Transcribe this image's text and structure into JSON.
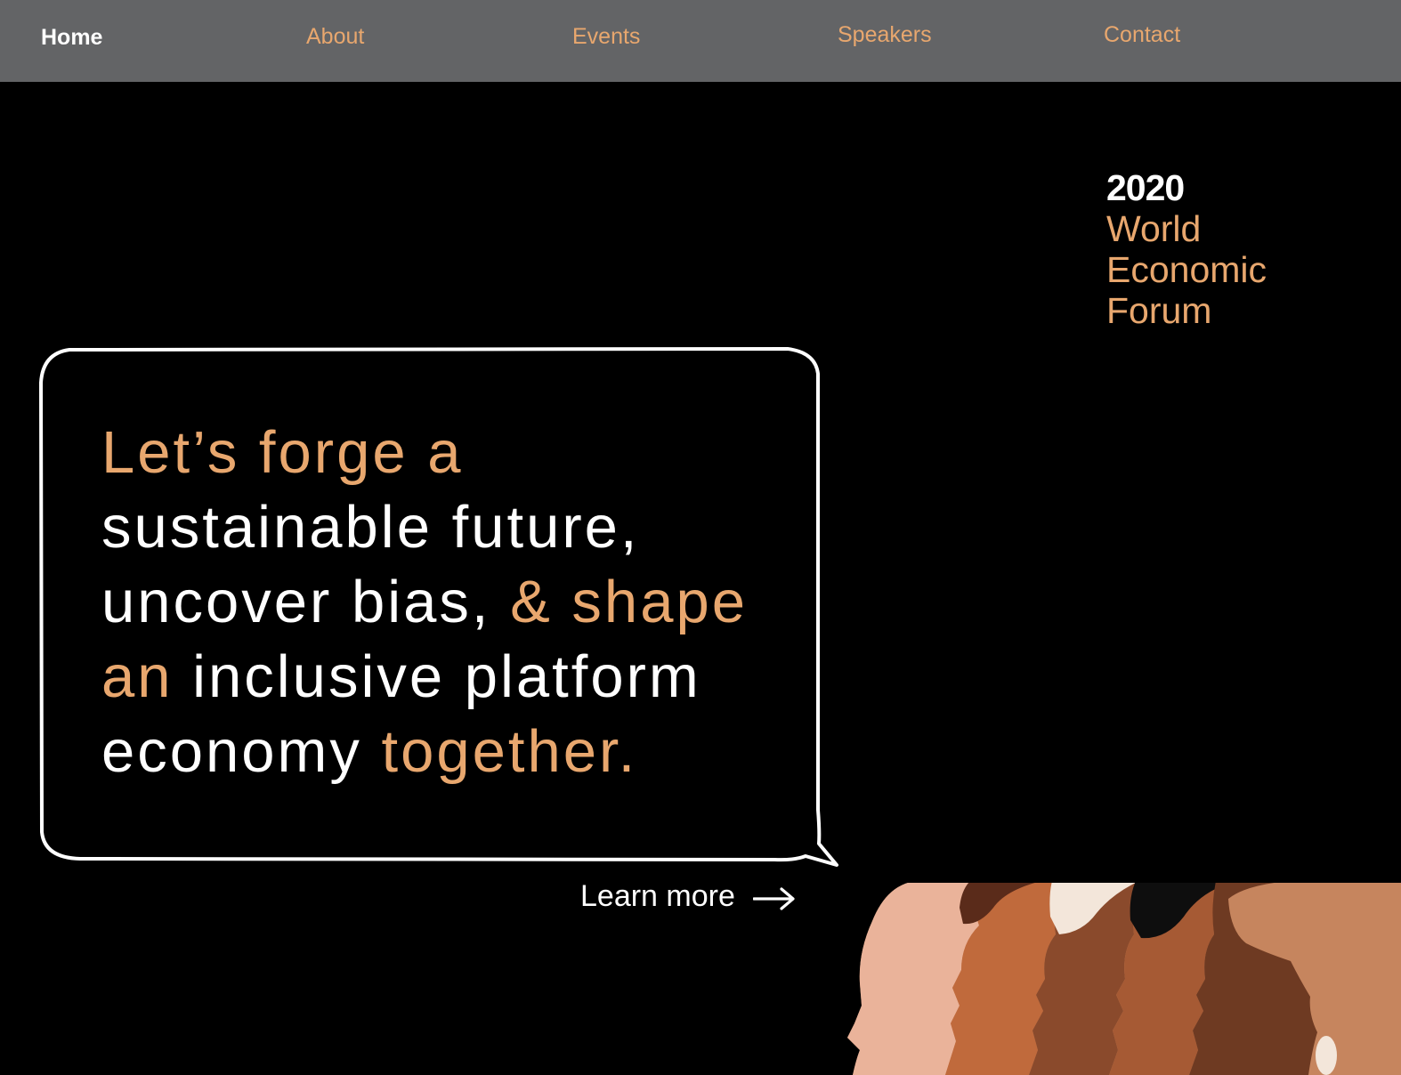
{
  "nav": {
    "items": [
      {
        "label": "Home",
        "active": true
      },
      {
        "label": "About",
        "active": false
      },
      {
        "label": "Events",
        "active": false
      },
      {
        "label": "Speakers",
        "active": false
      },
      {
        "label": "Contact",
        "active": false
      }
    ]
  },
  "brand": {
    "year": "2020",
    "line1": "World",
    "line2": "Economic",
    "line3": "Forum"
  },
  "hero": {
    "headline": {
      "part1": "Let’s forge a",
      "part2": "sustainable future,",
      "part3": "uncover bias, ",
      "part4": "& shape",
      "part5": "an",
      "part6": " inclusive platform",
      "part7": "economy ",
      "part8": "together."
    },
    "cta_label": "Learn more",
    "cta_icon": "arrow-right-icon"
  },
  "colors": {
    "accent": "#e8a76e",
    "nav_bg": "#636466",
    "background": "#000000",
    "text": "#ffffff"
  }
}
